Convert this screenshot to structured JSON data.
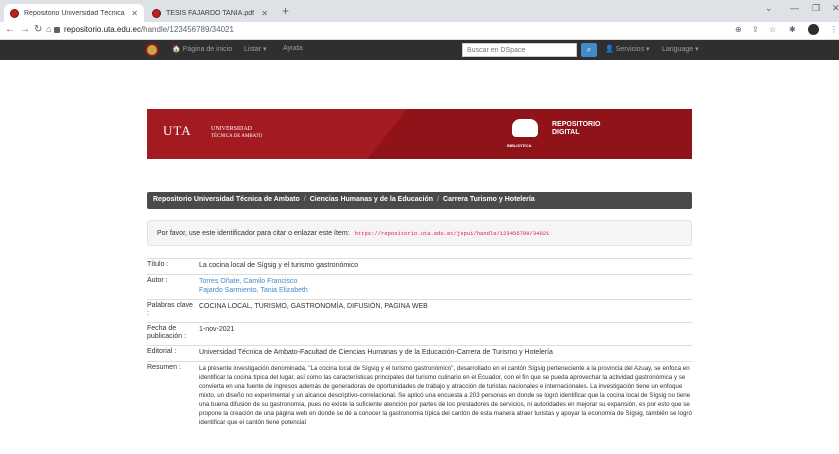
{
  "browser": {
    "tabs": [
      {
        "title": "Repositorio Universidad Técnica",
        "active": true
      },
      {
        "title": "TESIS FAJARDO TANIA.pdf",
        "active": false
      }
    ],
    "new_tab": "+",
    "url_host": "repositorio.uta.edu.ec",
    "url_path": "/handle/123456789/34021"
  },
  "navbar": {
    "home": "Página de inicio",
    "listar": "Listar ▾",
    "ayuda": "Ayuda",
    "search_placeholder": "Buscar en DSpace",
    "servicios": "Servicios ▾",
    "language": "Language ▾"
  },
  "banner": {
    "uta": "UTA",
    "uni_line1": "UNIVERSIDAD",
    "uni_line2": "TÉCNICA DE AMBATO",
    "repo_line1": "REPOSITORIO",
    "repo_line2": "DIGITAL",
    "biblioteca": "BIBLIOTECA"
  },
  "breadcrumb": [
    "Repositorio Universidad Técnica de Ambato",
    "Ciencias Humanas y de la Educación",
    "Carrera Turismo y Hotelería"
  ],
  "identifier": {
    "text": "Por favor, use este identificador para citar o enlazar este ítem:",
    "uri": "https://repositorio.uta.edu.ec/jspui/handle/123456789/34021"
  },
  "metadata": {
    "titulo_label": "Título :",
    "titulo": "La cocina local de Sígsig y el turismo gastronómico",
    "autor_label": "Autor :",
    "autores": [
      "Torres Oñate, Camilo Francisco",
      "Fajardo Sarmiento, Tania Elizabeth"
    ],
    "palabras_label": "Palabras clave :",
    "palabras": "COCINA LOCAL, TURISMO, GASTRONOMÍA, DIFUSIÓN, PAGINA WEB",
    "fecha_label": "Fecha de publicación :",
    "fecha": "1-nov-2021",
    "editorial_label": "Editorial :",
    "editorial": "Universidad Técnica de Ambato-Facultad de Ciencias Humanas y de la Educación-Carrera de Turismo y Hotelería",
    "resumen_label": "Resumen :",
    "resumen": "La presente investigación denominada, \"La cocina local de Sígsig y el turismo gastronómico\", desarrollado en el cantón Sígsig perteneciente a la provincia del Azuay, se enfoca en identificar la cocina típica del lugar, así como las características principales del turismo culinario en el Ecuador, con el fin que se pueda aprovechar la actividad gastronómica y se convierta en una fuente de ingresos además de generadoras de oportunidades de trabajo y atracción de turistas nacionales e internacionales. La investigación tiene un enfoque mixto, un diseño no experimental y un alcance descriptivo-correlacional. Se aplicó una encuesta a 203 personas en donde se logró identificar que la cocina local de Sígsig no tiene una buena difusión de su gastronomía, pues no existe la suficiente atención por partes de los prestadores de servicios, ni autoridades en mejorar su expansión, es por esto que se propone la creación de una página web en donde se dé a conocer la gastronomía típica del cantón de esta manera atraer turistas y apoyar la economía de Sígsig, también se logró identificar que el cantón tiene potencial"
  }
}
